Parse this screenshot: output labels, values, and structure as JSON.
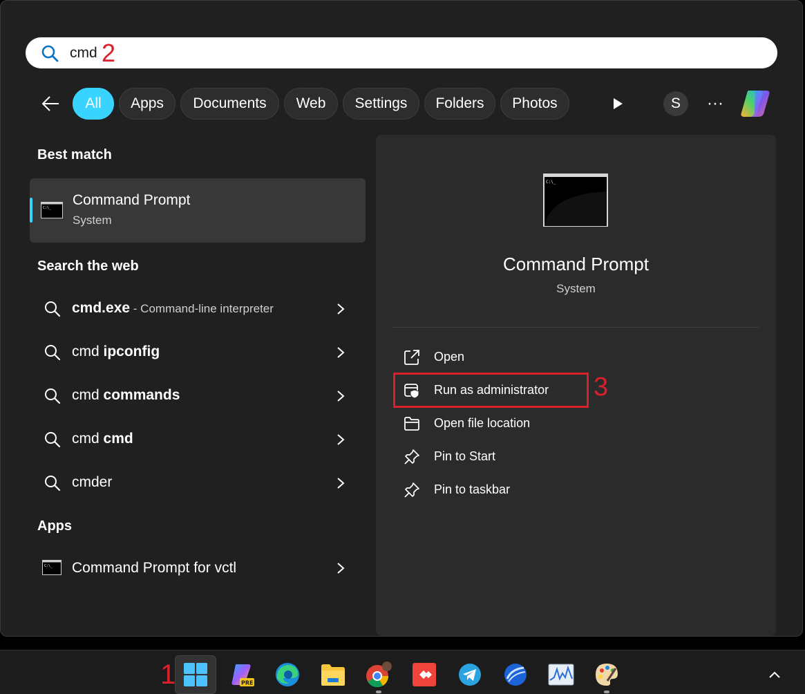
{
  "search": {
    "query": "cmd",
    "step_marker": "2"
  },
  "filters": [
    {
      "label": "All",
      "active": true
    },
    {
      "label": "Apps"
    },
    {
      "label": "Documents"
    },
    {
      "label": "Web"
    },
    {
      "label": "Settings"
    },
    {
      "label": "Folders"
    },
    {
      "label": "Photos"
    }
  ],
  "account": {
    "initial": "S"
  },
  "more_label": "···",
  "best_match": {
    "heading": "Best match",
    "title": "Command Prompt",
    "subtitle": "System"
  },
  "web": {
    "heading": "Search the web",
    "items": [
      {
        "prefix": "cmd.exe",
        "bold": "",
        "desc": " - Command-line interpreter",
        "prefix_bold": true
      },
      {
        "prefix": "cmd ",
        "bold": "ipconfig",
        "desc": ""
      },
      {
        "prefix": "cmd ",
        "bold": "commands",
        "desc": ""
      },
      {
        "prefix": "cmd ",
        "bold": "cmd",
        "desc": ""
      },
      {
        "prefix": "cmder",
        "bold": "",
        "desc": ""
      }
    ]
  },
  "apps": {
    "heading": "Apps",
    "items": [
      {
        "title": "Command Prompt for vctl"
      }
    ]
  },
  "detail": {
    "title": "Command Prompt",
    "subtitle": "System",
    "actions": [
      {
        "label": "Open",
        "icon": "open-external-icon"
      },
      {
        "label": "Run as administrator",
        "icon": "shield-admin-icon"
      },
      {
        "label": "Open file location",
        "icon": "folder-icon"
      },
      {
        "label": "Pin to Start",
        "icon": "pin-icon"
      },
      {
        "label": "Pin to taskbar",
        "icon": "pin-icon"
      }
    ],
    "step_marker": "3"
  },
  "taskbar": {
    "step_marker": "1",
    "items": [
      "start-button",
      "copilot-pre-app",
      "edge-browser",
      "file-explorer",
      "chrome-browser",
      "anydesk-app",
      "telegram-app",
      "browser-app",
      "resource-monitor-app",
      "paint-app"
    ],
    "colors": {
      "accent": "#39d3ff",
      "marker": "#d9202b"
    }
  }
}
